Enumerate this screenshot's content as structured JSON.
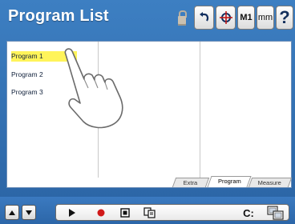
{
  "header": {
    "title": "Program List",
    "buttons": [
      {
        "name": "undo-button",
        "icon": "undo-icon"
      },
      {
        "name": "probe-button",
        "icon": "crosshair-probe-icon"
      },
      {
        "name": "m1-button",
        "label": "M1"
      },
      {
        "name": "units-button",
        "label": "mm"
      },
      {
        "name": "help-button",
        "label": "?"
      }
    ],
    "lock_icon": "lock-icon"
  },
  "programs": [
    {
      "label": "Program 1",
      "selected": true
    },
    {
      "label": "Program 2",
      "selected": false
    },
    {
      "label": "Program 3",
      "selected": false
    }
  ],
  "tabs": [
    {
      "label": "Extra",
      "active": false
    },
    {
      "label": "Program",
      "active": true
    },
    {
      "label": "Measure",
      "active": false
    }
  ],
  "toolbar": {
    "drive_label": "C:",
    "icons": [
      "up-arrow-icon",
      "down-arrow-icon",
      "play-icon",
      "record-icon",
      "stop-icon",
      "copy-icon",
      "drive-icon"
    ]
  },
  "colors": {
    "background": "#2f6eb0",
    "selection": "#fff45a",
    "record": "#d01818"
  }
}
